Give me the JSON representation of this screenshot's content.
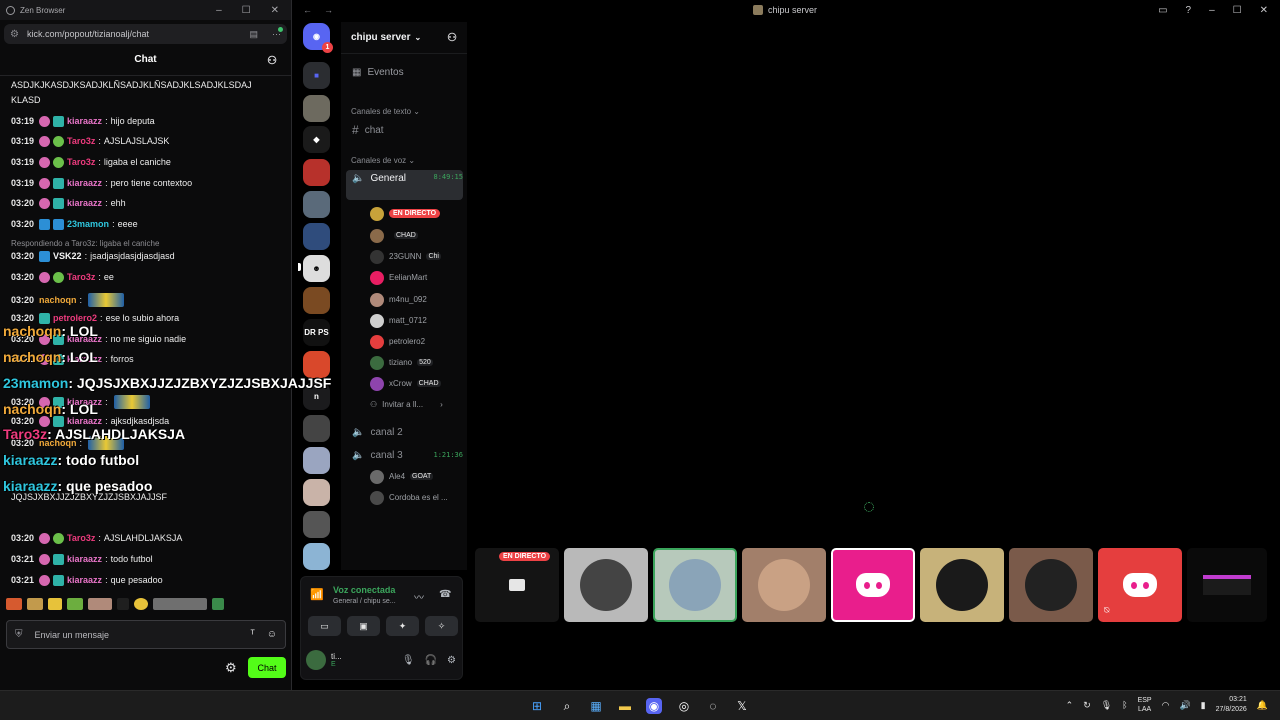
{
  "browser": {
    "window_title": "Zen Browser",
    "url": "kick.com/popout/tizianoalj/chat",
    "chat_header": "Chat",
    "send_placeholder": "Enviar un mensaje",
    "chat_button": "Chat"
  },
  "chat": {
    "first_line_1": "ASDJKJKASDJKSADJKLÑSADJKLÑSADJKLSADJKLSDAJ",
    "first_line_2": "KLASD",
    "messages": [
      {
        "time": "03:19",
        "user": "kiaraazz",
        "color": "#e875c8",
        "text": "hijo deputa"
      },
      {
        "time": "03:19",
        "user": "Taro3z",
        "color": "#ee3b7e",
        "text": "AJSLAJSLAJSK"
      },
      {
        "time": "03:19",
        "user": "Taro3z",
        "color": "#ee3b7e",
        "text": "ligaba el caniche"
      },
      {
        "time": "03:19",
        "user": "kiaraazz",
        "color": "#e875c8",
        "text": "pero tiene contextoo"
      },
      {
        "time": "03:20",
        "user": "kiaraazz",
        "color": "#e875c8",
        "text": "ehh"
      },
      {
        "time": "03:20",
        "user": "23mamon",
        "color": "#2fc6de",
        "text": "eeee"
      },
      {
        "time": "03:20",
        "user": "VSK22",
        "color": "#f5f5f5",
        "text": "jsadjasjdasjdjasdjasd"
      },
      {
        "time": "03:20",
        "user": "Taro3z",
        "color": "#ee3b7e",
        "text": "ee"
      },
      {
        "time": "03:20",
        "user": "nachoqn",
        "color": "#f0a93a",
        "text": ""
      },
      {
        "time": "03:20",
        "user": "petrolero2",
        "color": "#ee3b7e",
        "text": "ese lo subio ahora"
      },
      {
        "time": "03:20",
        "user": "kiaraazz",
        "color": "#e875c8",
        "text": "no me siguio nadie"
      },
      {
        "time": "03:20",
        "user": "kiaraazz",
        "color": "#e875c8",
        "text": "forros"
      },
      {
        "time": "03:20",
        "user": "kiaraazz",
        "color": "#e875c8",
        "text": ""
      },
      {
        "time": "03:20",
        "user": "kiaraazz",
        "color": "#e875c8",
        "text": "ajksdjkasdjsda"
      },
      {
        "time": "03:20",
        "user": "nachoqn",
        "color": "#f0a93a",
        "text": ""
      },
      {
        "time": "03:20",
        "user": "Taro3z",
        "color": "#ee3b7e",
        "text": "AJSLAHDLJAKSJA"
      },
      {
        "time": "03:21",
        "user": "kiaraazz",
        "color": "#e875c8",
        "text": "todo futbol"
      },
      {
        "time": "03:21",
        "user": "kiaraazz",
        "color": "#e875c8",
        "text": "que pesadoo"
      }
    ],
    "reply_note": "Respondiendo a Taro3z: ligaba el caniche",
    "long_line": "JQJSJXBXJJZJZBXYZJZJSBXJAJJSF",
    "overlays": [
      {
        "user": "nachoqn",
        "text": "LOL"
      },
      {
        "user": "nachoqn",
        "text": "LOL"
      },
      {
        "user": "23mamon",
        "text": "JQJSJXBXJJZJZBXYZJZJSBXJAJJSF"
      },
      {
        "user": "nachoqn",
        "text": "LOL"
      },
      {
        "user": "Taro3z",
        "text": "AJSLAHDLJAKSJA"
      },
      {
        "user": "kiaraazz",
        "text": "todo futbol"
      },
      {
        "user": "kiaraazz",
        "text": "que pesadoo"
      }
    ]
  },
  "discord": {
    "title": "chipu server",
    "server_name": "chipu server",
    "events": "Eventos",
    "text_category": "Canales de texto",
    "text_channel": "chat",
    "voice_category": "Canales de voz",
    "general": {
      "name": "General",
      "time": "8:49:15"
    },
    "live_badge": "EN DIRECTO",
    "users": [
      {
        "name": "",
        "tag": "CHAD"
      },
      {
        "name": "23GUNN",
        "tag": "Chi"
      },
      {
        "name": "EelianMart",
        "tag": ""
      },
      {
        "name": "m4nu_092",
        "tag": ""
      },
      {
        "name": "matt_0712",
        "tag": ""
      },
      {
        "name": "petrolero2",
        "tag": ""
      },
      {
        "name": "tiziano",
        "tag": "520"
      },
      {
        "name": "xCrow",
        "tag": "CHAD"
      }
    ],
    "invite": "Invitar a ll...",
    "canal2": "canal 2",
    "canal3": {
      "name": "canal 3",
      "time": "1:21:36"
    },
    "canal3_users": [
      {
        "name": "Ale4",
        "tag": "GOAT"
      },
      {
        "name": "Cordoba es el ...",
        "tag": ""
      }
    ],
    "voice_connected": "Voz conectada",
    "voice_sub": "General / chipu se...",
    "me_short": "ti...",
    "me_status": "E",
    "notif_count": "1",
    "drops_label": "DR PS",
    "n_label": "n"
  },
  "taskbar": {
    "lang1": "ESP",
    "lang2": "LAA",
    "time": "03:21",
    "date": "27/8/2026"
  }
}
